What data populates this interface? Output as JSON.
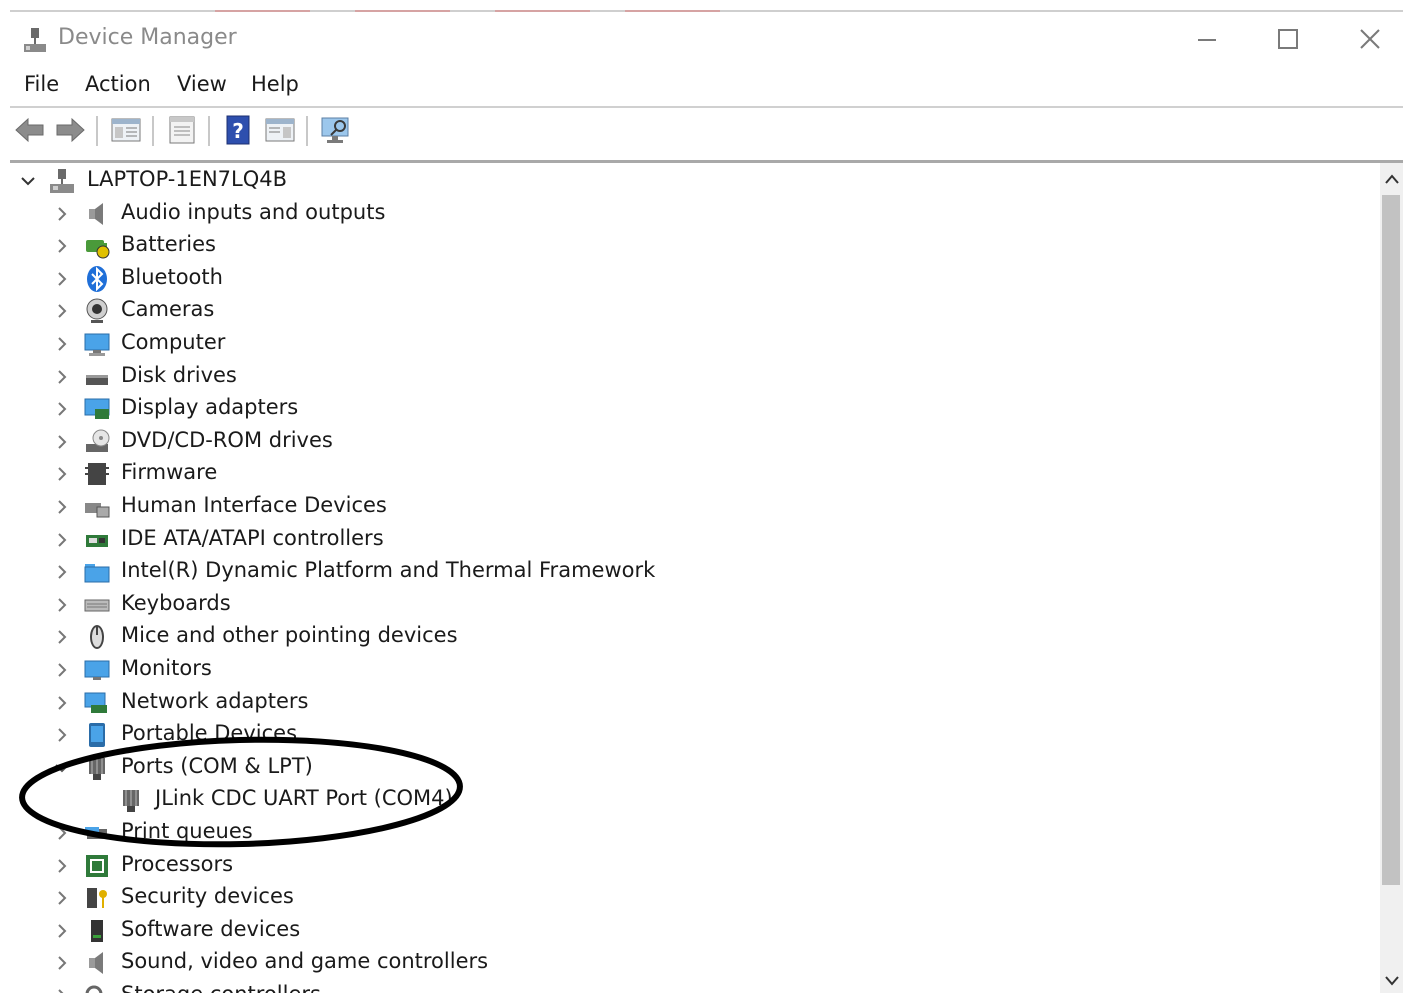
{
  "window": {
    "title": "Device Manager",
    "controls": {
      "minimize": "minimize",
      "maximize": "maximize",
      "close": "close"
    }
  },
  "menu": [
    "File",
    "Action",
    "View",
    "Help"
  ],
  "toolbar": {
    "buttons": [
      "back-arrow-icon",
      "forward-arrow-icon",
      "show-hide-console-tree-icon",
      "properties-icon",
      "help-icon",
      "action-pane-icon",
      "scan-hardware-icon"
    ]
  },
  "tree": {
    "root": "LAPTOP-1EN7LQ4B",
    "categories": [
      {
        "label": "Audio inputs and outputs",
        "icon": "speaker-icon"
      },
      {
        "label": "Batteries",
        "icon": "battery-icon"
      },
      {
        "label": "Bluetooth",
        "icon": "bluetooth-icon"
      },
      {
        "label": "Cameras",
        "icon": "camera-icon"
      },
      {
        "label": "Computer",
        "icon": "computer-icon"
      },
      {
        "label": "Disk drives",
        "icon": "disk-drive-icon"
      },
      {
        "label": "Display adapters",
        "icon": "display-adapter-icon"
      },
      {
        "label": "DVD/CD-ROM drives",
        "icon": "dvd-drive-icon"
      },
      {
        "label": "Firmware",
        "icon": "firmware-icon"
      },
      {
        "label": "Human Interface Devices",
        "icon": "hid-icon"
      },
      {
        "label": "IDE ATA/ATAPI controllers",
        "icon": "ide-controller-icon"
      },
      {
        "label": "Intel(R) Dynamic Platform and Thermal Framework",
        "icon": "folder-icon"
      },
      {
        "label": "Keyboards",
        "icon": "keyboard-icon"
      },
      {
        "label": "Mice and other pointing devices",
        "icon": "mouse-icon"
      },
      {
        "label": "Monitors",
        "icon": "monitor-icon"
      },
      {
        "label": "Network adapters",
        "icon": "network-adapter-icon"
      },
      {
        "label": "Portable Devices",
        "icon": "portable-device-icon"
      },
      {
        "label": "Ports (COM & LPT)",
        "icon": "port-icon",
        "expanded": true,
        "children": [
          {
            "label": "JLink CDC UART Port (COM4)",
            "icon": "port-icon"
          }
        ]
      },
      {
        "label": "Print queues",
        "icon": "printer-icon"
      },
      {
        "label": "Processors",
        "icon": "processor-icon"
      },
      {
        "label": "Security devices",
        "icon": "security-device-icon"
      },
      {
        "label": "Software devices",
        "icon": "software-device-icon"
      },
      {
        "label": "Sound, video and game controllers",
        "icon": "sound-icon"
      },
      {
        "label": "Storage controllers",
        "icon": "storage-controller-icon"
      }
    ]
  },
  "annotation": {
    "shape": "ellipse",
    "color": "#000000",
    "highlights": "Ports (COM & LPT)"
  }
}
